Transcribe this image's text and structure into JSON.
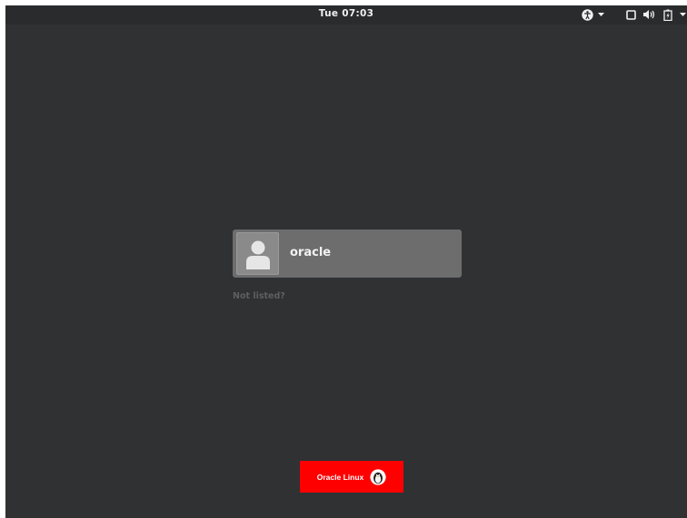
{
  "top_bar": {
    "clock": "Tue 07:03",
    "icons": [
      "accessibility-icon",
      "chevron-down-icon",
      "display-icon",
      "volume-icon",
      "battery-icon",
      "chevron-down-icon"
    ]
  },
  "login": {
    "user_name": "oracle",
    "not_listed": "Not listed?"
  },
  "branding": {
    "text": "Oracle Linux",
    "logo": "penguin-logo"
  },
  "colors": {
    "background": "#2f3133",
    "top_bar": "#292b2d",
    "user_card": "#6d6d6d",
    "brand": "#ff0000"
  }
}
